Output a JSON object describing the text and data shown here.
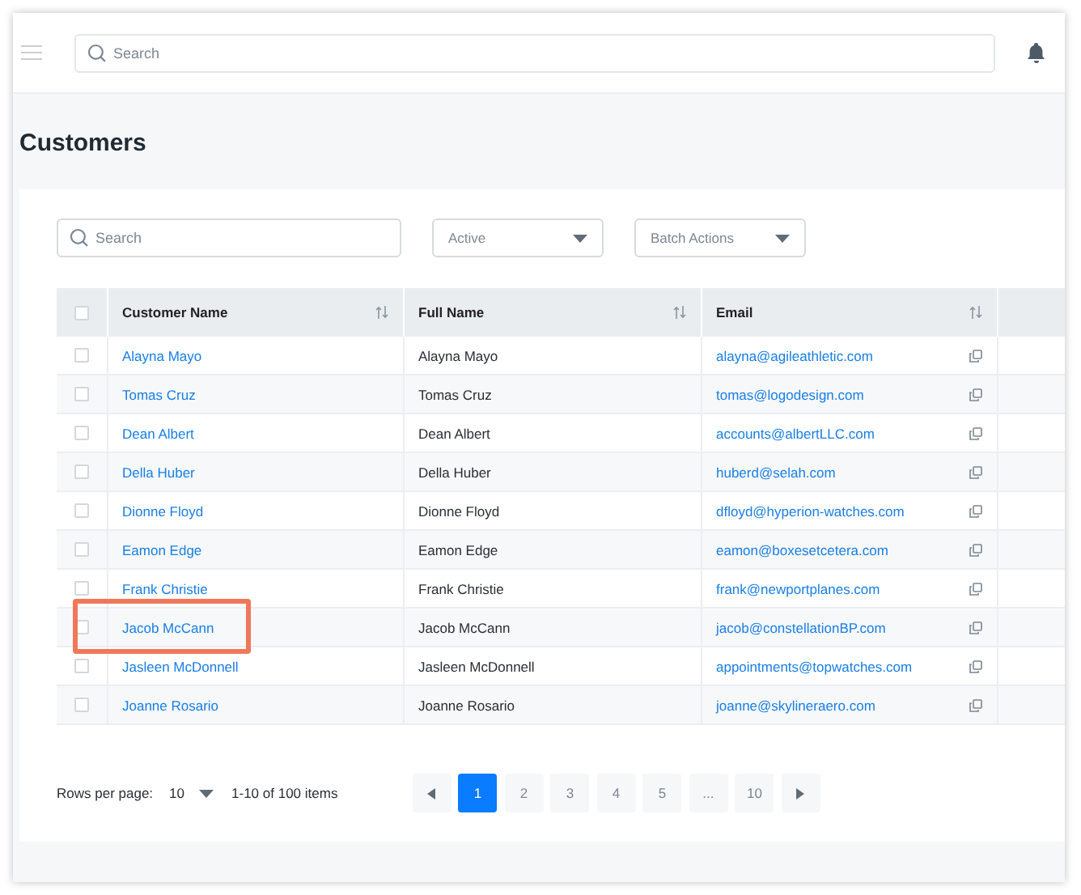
{
  "header": {
    "search": {
      "placeholder": "Search"
    }
  },
  "page_title": "Customers",
  "filters": {
    "search": {
      "placeholder": "Search"
    },
    "status_dropdown": "Active",
    "batch_dropdown": "Batch Actions"
  },
  "table": {
    "select_all_checked": false,
    "columns": [
      {
        "label": "Customer Name"
      },
      {
        "label": "Full Name"
      },
      {
        "label": "Email"
      }
    ],
    "rows": [
      {
        "checked": false,
        "highlighted": false,
        "customer_name": "Alayna Mayo",
        "full_name": "Alayna Mayo",
        "email": "alayna@agileathletic.com"
      },
      {
        "checked": false,
        "highlighted": false,
        "customer_name": "Tomas Cruz",
        "full_name": "Tomas Cruz",
        "email": "tomas@logodesign.com"
      },
      {
        "checked": false,
        "highlighted": false,
        "customer_name": "Dean Albert",
        "full_name": "Dean Albert",
        "email": "accounts@albertLLC.com"
      },
      {
        "checked": false,
        "highlighted": false,
        "customer_name": "Della Huber",
        "full_name": "Della Huber",
        "email": "huberd@selah.com"
      },
      {
        "checked": false,
        "highlighted": false,
        "customer_name": "Dionne Floyd",
        "full_name": "Dionne Floyd",
        "email": "dfloyd@hyperion-watches.com"
      },
      {
        "checked": false,
        "highlighted": false,
        "customer_name": "Eamon Edge",
        "full_name": "Eamon Edge",
        "email": "eamon@boxesetcetera.com"
      },
      {
        "checked": false,
        "highlighted": false,
        "customer_name": "Frank Christie",
        "full_name": "Frank Christie",
        "email": "frank@newportplanes.com"
      },
      {
        "checked": false,
        "highlighted": true,
        "customer_name": "Jacob McCann",
        "full_name": "Jacob McCann",
        "email": "jacob@constellationBP.com"
      },
      {
        "checked": false,
        "highlighted": false,
        "customer_name": "Jasleen McDonnell",
        "full_name": "Jasleen McDonnell",
        "email": "appointments@topwatches.com"
      },
      {
        "checked": false,
        "highlighted": false,
        "customer_name": "Joanne Rosario",
        "full_name": "Joanne Rosario",
        "email": "joanne@skylineraero.com"
      }
    ]
  },
  "footer": {
    "rows_per_page_label": "Rows per page:",
    "rows_per_page": "10",
    "range": "1-10 of 100 items",
    "pages": [
      {
        "label": "1",
        "selected": true
      },
      {
        "label": "2",
        "selected": false
      },
      {
        "label": "3",
        "selected": false
      },
      {
        "label": "4",
        "selected": false
      },
      {
        "label": "5",
        "selected": false
      },
      {
        "label": "...",
        "selected": false
      },
      {
        "label": "10",
        "selected": false
      }
    ]
  }
}
